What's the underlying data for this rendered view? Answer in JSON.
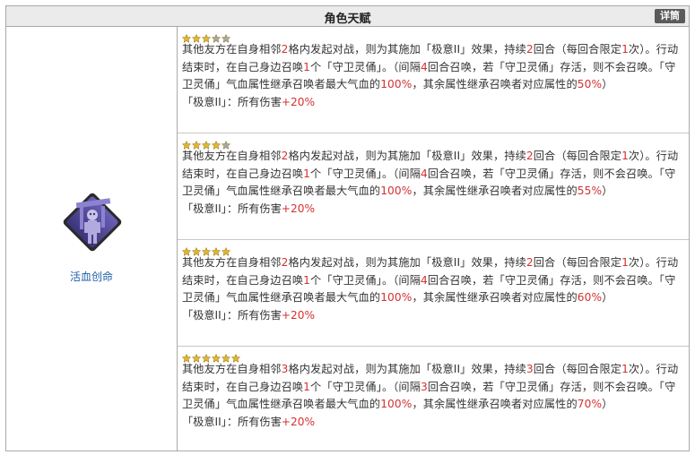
{
  "header": {
    "title": "角色天赋",
    "detail_button": "详筒"
  },
  "talent": {
    "name": "活血创命",
    "icon": "skeleton-summon-icon"
  },
  "colors": {
    "highlight": "#d43131",
    "star_filled": "#e2b62d",
    "star_empty": "#a8a8a8",
    "icon_bg": "#5a4fa0"
  },
  "levels": [
    {
      "stars_filled": 3,
      "stars_total": 5,
      "t1": "其他友方在自身相邻",
      "n1": "2",
      "t2": "格内发起对战，则为其施加「极意II」效果，持续",
      "n2": "2",
      "t3": "回合（每回合限定",
      "n3": "1",
      "t4": "次）。行动结束时，在自己身边召唤",
      "n4": "1",
      "t5": "个「守卫灵俑」。（间隔",
      "n5": "4",
      "t6": "回合召唤，若「守卫灵俑」存活，则不会召唤。「守卫灵俑」气血属性继承召唤者最大气血的",
      "n6": "100%",
      "t7": "，其余属性继承召唤者对应属性的",
      "n7": "50%",
      "t8": "）",
      "bonus_label": "「极意II」：所有伤害",
      "bonus_value": "+20%"
    },
    {
      "stars_filled": 4,
      "stars_total": 5,
      "t1": "其他友方在自身相邻",
      "n1": "2",
      "t2": "格内发起对战，则为其施加「极意II」效果，持续",
      "n2": "2",
      "t3": "回合（每回合限定",
      "n3": "1",
      "t4": "次）。行动结束时，在自己身边召唤",
      "n4": "1",
      "t5": "个「守卫灵俑」。（间隔",
      "n5": "4",
      "t6": "回合召唤，若「守卫灵俑」存活，则不会召唤。「守卫灵俑」气血属性继承召唤者最大气血的",
      "n6": "100%",
      "t7": "，其余属性继承召唤者对应属性的",
      "n7": "55%",
      "t8": "）",
      "bonus_label": "「极意II」：所有伤害",
      "bonus_value": "+20%"
    },
    {
      "stars_filled": 5,
      "stars_total": 5,
      "t1": "其他友方在自身相邻",
      "n1": "2",
      "t2": "格内发起对战，则为其施加「极意II」效果，持续",
      "n2": "2",
      "t3": "回合（每回合限定",
      "n3": "1",
      "t4": "次）。行动结束时，在自己身边召唤",
      "n4": "1",
      "t5": "个「守卫灵俑」。（间隔",
      "n5": "4",
      "t6": "回合召唤，若「守卫灵俑」存活，则不会召唤。「守卫灵俑」气血属性继承召唤者最大气血的",
      "n6": "100%",
      "t7": "，其余属性继承召唤者对应属性的",
      "n7": "60%",
      "t8": "）",
      "bonus_label": "「极意II」：所有伤害",
      "bonus_value": "+20%"
    },
    {
      "stars_filled": 6,
      "stars_total": 6,
      "t1": "其他友方在自身相邻",
      "n1": "3",
      "t2": "格内发起对战，则为其施加「极意II」效果，持续",
      "n2": "3",
      "t3": "回合（每回合限定",
      "n3": "1",
      "t4": "次）。行动结束时，在自己身边召唤",
      "n4": "1",
      "t5": "个「守卫灵俑」。（间隔",
      "n5": "3",
      "t6": "回合召唤，若「守卫灵俑」存活，则不会召唤。「守卫灵俑」气血属性继承召唤者最大气血的",
      "n6": "100%",
      "t7": "，其余属性继承召唤者对应属性的",
      "n7": "70%",
      "t8": "）",
      "bonus_label": "「极意II」：所有伤害",
      "bonus_value": "+20%"
    }
  ]
}
